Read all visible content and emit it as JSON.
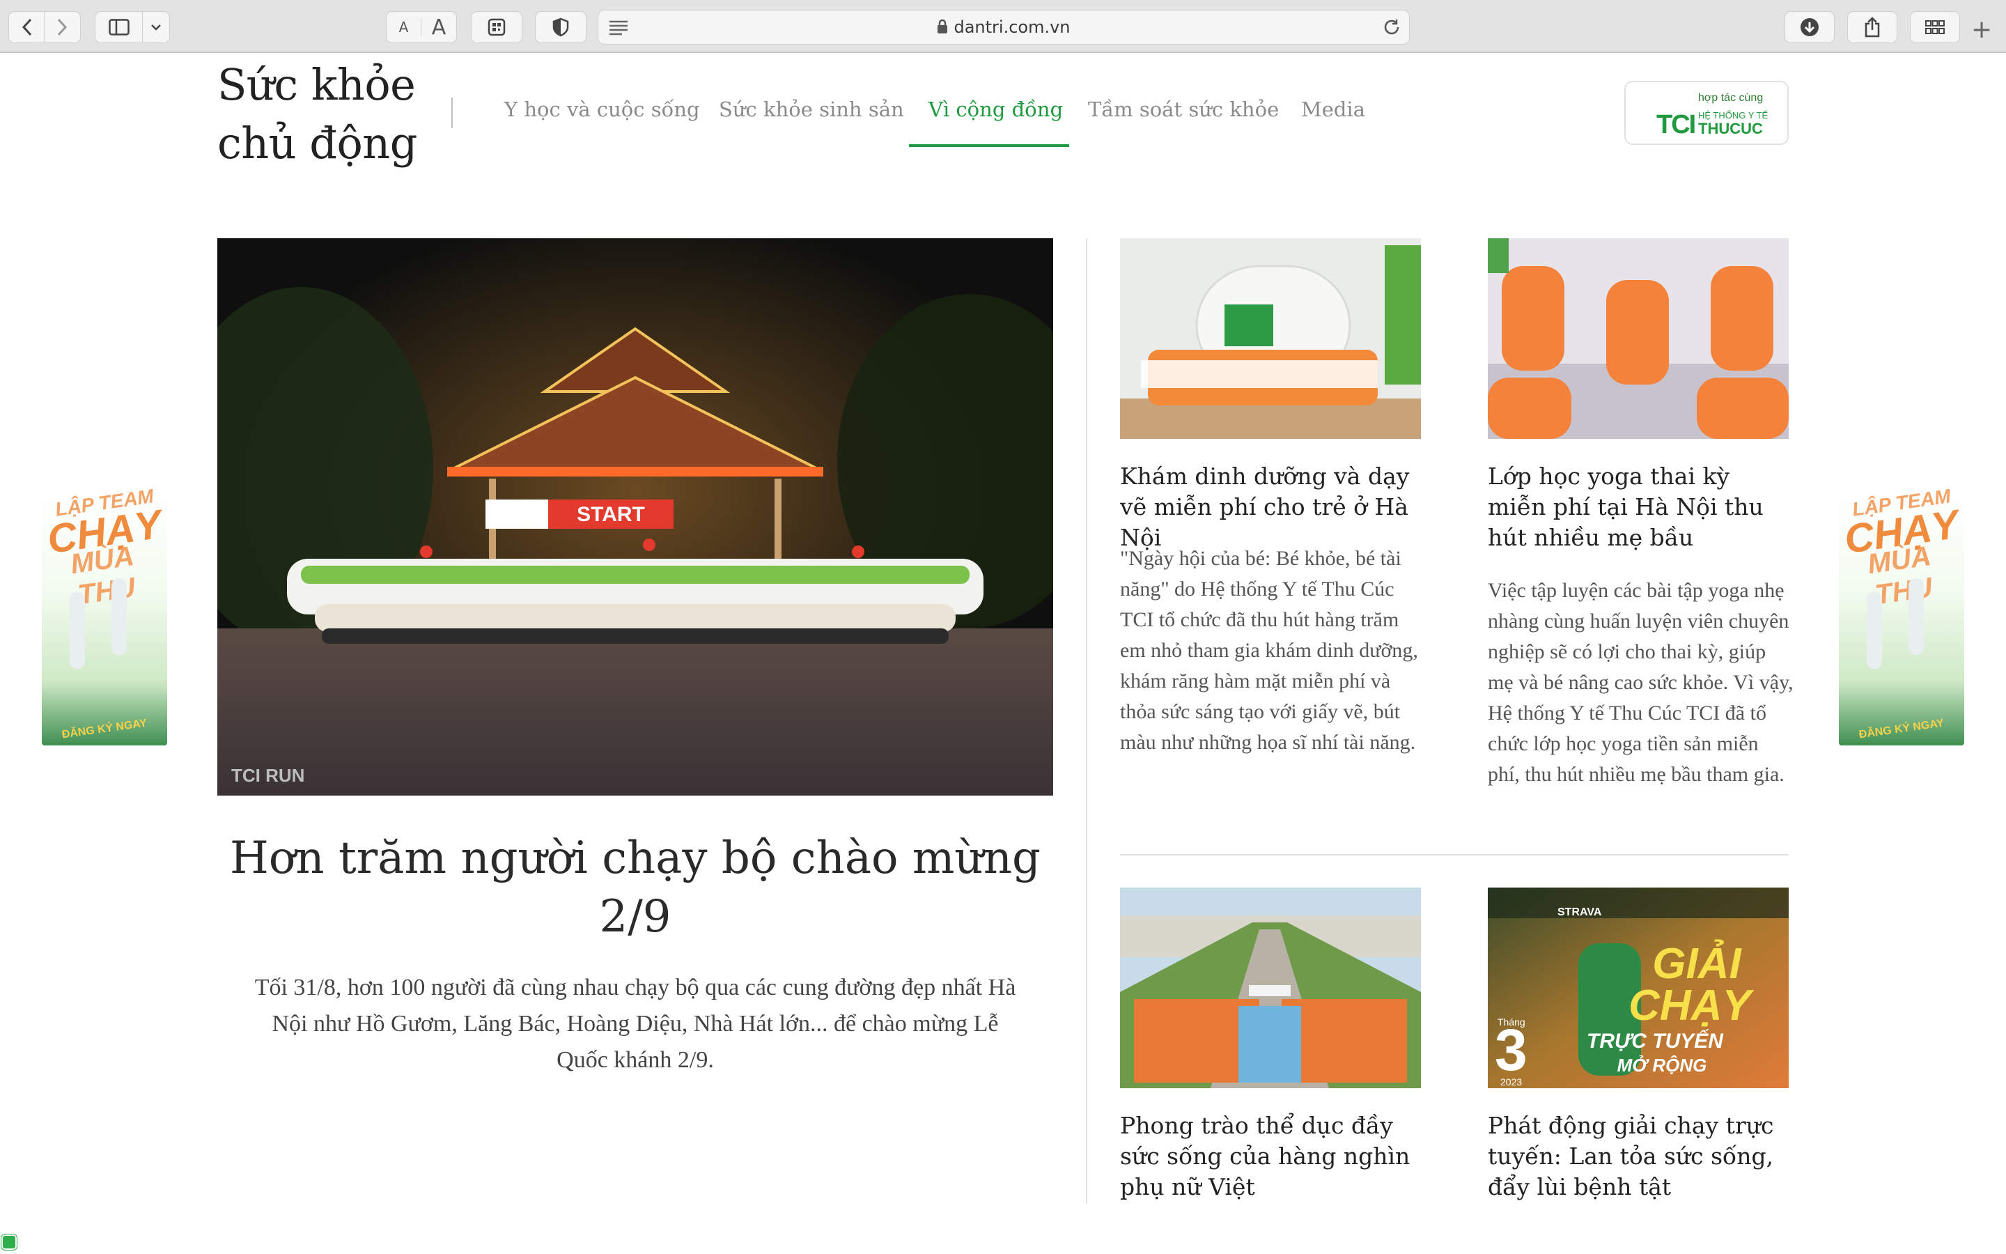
{
  "browser": {
    "url": "dantri.com.vn",
    "text_small_label": "A",
    "text_large_label": "A"
  },
  "site": {
    "title_line1": "Sức khỏe",
    "title_line2": "chủ động"
  },
  "nav": {
    "items": [
      {
        "label": "Y học và cuộc sống"
      },
      {
        "label": "Sức khỏe sinh sản"
      },
      {
        "label": "Vì cộng đồng",
        "active": true
      },
      {
        "label": "Tầm soát sức khỏe"
      },
      {
        "label": "Media"
      }
    ]
  },
  "partner": {
    "caption": "hợp tác cùng",
    "logo_text": "TCI",
    "system_label": "HỆ THỐNG Y TẾ",
    "name": "THUCUC"
  },
  "side_ad": {
    "line1": "LẬP TEAM",
    "line2": "CHẠY",
    "line3": "MÙA THU",
    "cta": "ĐĂNG KÝ NGAY"
  },
  "featured": {
    "title": "Hơn trăm người chạy bộ chào mừng 2/9",
    "description": "Tối 31/8, hơn 100 người đã cùng nhau chạy bộ qua các cung đường đẹp nhất Hà Nội như Hồ Gươm, Lăng Bác, Hoàng Diệu, Nhà Hát lớn... để chào mừng Lễ Quốc khánh 2/9.",
    "image_banner": "START",
    "image_watermark": "TCI RUN"
  },
  "articles": [
    {
      "title": "Khám dinh dưỡng và dạy vẽ miễn phí cho trẻ ở Hà Nội",
      "description": "\"Ngày hội của bé: Bé khỏe, bé tài năng\" do Hệ thống Y tế Thu Cúc TCI tổ chức đã thu hút hàng trăm em nhỏ tham gia khám dinh dưỡng, khám răng hàm mặt miễn phí và thỏa sức sáng tạo với giấy vẽ, bút màu như những họa sĩ nhí tài năng."
    },
    {
      "title": "Lớp học yoga thai kỳ miễn phí tại Hà Nội thu hút nhiều mẹ bầu",
      "description": "Việc tập luyện các bài tập yoga nhẹ nhàng cùng huấn luyện viên chuyên nghiệp sẽ có lợi cho thai kỳ, giúp mẹ và bé nâng cao sức khỏe. Vì vậy, Hệ thống Y tế Thu Cúc TCI đã tổ chức lớp học yoga tiền sản miễn phí, thu hút nhiều mẹ bầu tham gia."
    },
    {
      "title": "Phong trào thể dục đầy sức sống của hàng nghìn phụ nữ Việt"
    },
    {
      "title": "Phát động giải chạy trực tuyến: Lan tỏa sức sống, đẩy lùi bệnh tật",
      "image_text": {
        "brand": "STRAVA",
        "headline1": "GIẢI",
        "headline2": "CHẠY",
        "month_label": "Tháng",
        "month_number": "3",
        "year": "2023",
        "sub1": "TRỰC TUYẾN",
        "sub2": "MỞ RỘNG"
      }
    }
  ],
  "colors": {
    "accent": "#1f9a3e",
    "nav_inactive": "#8a8a8a",
    "text": "#222222"
  }
}
